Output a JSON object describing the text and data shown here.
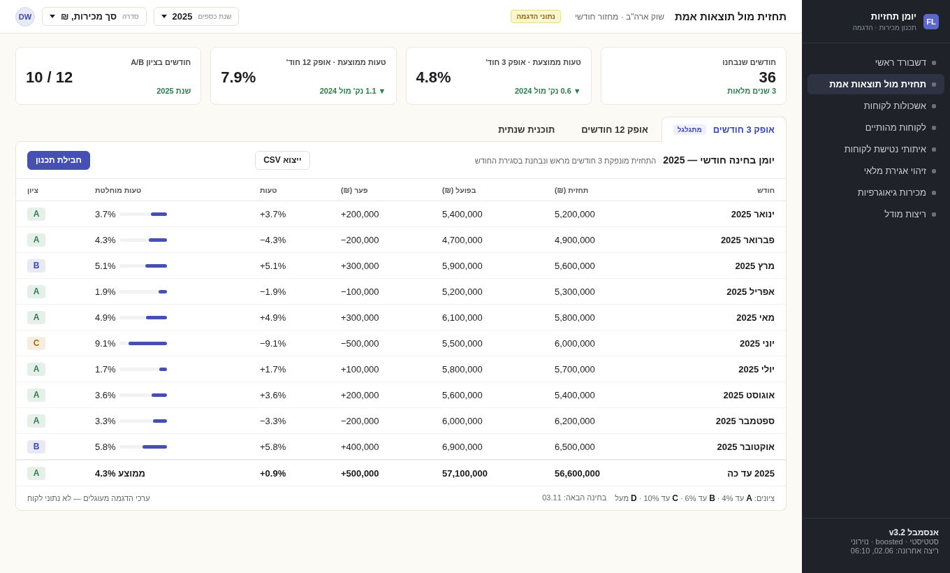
{
  "sidebar": {
    "logo": "FL",
    "title": "יומן תחזיות",
    "subtitle": "תכנון מכירות · הדגמה",
    "items": [
      {
        "label": "דשבורד ראשי",
        "selected": false
      },
      {
        "label": "תחזית מול תוצאות אמת",
        "selected": true
      },
      {
        "label": "אשכולות לקוחות",
        "selected": false
      },
      {
        "label": "לקוחות מהותיים",
        "selected": false
      },
      {
        "label": "איתותי נטישת לקוחות",
        "selected": false
      },
      {
        "label": "זיהוי אגירת מלאי",
        "selected": false
      },
      {
        "label": "מכירות גיאוגרפיות",
        "selected": false
      },
      {
        "label": "ריצות מודל",
        "selected": false
      }
    ],
    "footer": {
      "title": "אנסמבל v3.2",
      "lines": [
        "סטטיסטי · boosted · נוירוני",
        "ריצה אחרונה: 02.06, 06:10"
      ]
    }
  },
  "header": {
    "title": "תחזית מול תוצאות אמת",
    "subtitle": "שוק ארה\"ב · מחזור חודשי",
    "badge": "נתוני הדגמה",
    "filters": [
      {
        "label": "שנת כספים",
        "value": "2025"
      },
      {
        "label": "סדרה",
        "value": "סך מכירות, ₪"
      }
    ],
    "avatar": "DW"
  },
  "kpis": [
    {
      "kind": "total",
      "label": "חודשים שנבחנו",
      "value": "36",
      "note": "3 שנים מלאות"
    },
    {
      "kind": "metric",
      "label": "טעות ממוצעת · אופק 3 חוד'",
      "value": "4.8%",
      "note": "▼ 0.6 נק' מול 2024"
    },
    {
      "kind": "metric",
      "label": "טעות ממוצעת · אופק 12 חוד'",
      "value": "7.9%",
      "note": "▼ 1.1 נק' מול 2024"
    },
    {
      "kind": "metric",
      "label": "חודשים בציון A/B",
      "value": "10 / 12",
      "note": "שנת 2025"
    }
  ],
  "tabs": [
    {
      "label": "אופק 3 חודשים",
      "badge": "מתגלגל",
      "selected": true
    },
    {
      "label": "אופק 12 חודשים",
      "selected": false
    },
    {
      "label": "תוכנית שנתית",
      "selected": false
    }
  ],
  "panel": {
    "title": "יומן בחינה חודשי — 2025",
    "subtitle": "התחזית מונפקת 3 חודשים מראש ונבחנת בסגירת החודש",
    "buttons": [
      {
        "label": "ייצוא CSV",
        "kind": "secondary"
      },
      {
        "label": "חבילת תכנון",
        "kind": "primary"
      }
    ]
  },
  "table": {
    "columns": [
      "חודש",
      "תחזית (₪)",
      "בפועל (₪)",
      "פער (₪)",
      "טעות",
      "טעות מוחלטת",
      "ציון"
    ],
    "rows": [
      {
        "month": "ינואר 2025",
        "forecast": "5,200,000",
        "actual": "5,400,000",
        "gap": "+200,000",
        "error": "+3.7%",
        "abs_error": "3.7%",
        "level": 0.33,
        "grade": {
          "label": "A",
          "color": "#2e7d4e"
        }
      },
      {
        "month": "פברואר 2025",
        "forecast": "4,900,000",
        "actual": "4,700,000",
        "gap": "−200,000",
        "error": "−4.3%",
        "abs_error": "4.3%",
        "level": 0.38,
        "grade": {
          "label": "A",
          "color": "#2e7d4e"
        }
      },
      {
        "month": "מרץ 2025",
        "forecast": "5,600,000",
        "actual": "5,900,000",
        "gap": "+300,000",
        "error": "+5.1%",
        "abs_error": "5.1%",
        "level": 0.45,
        "grade": {
          "label": "B",
          "color": "#3f4aa8"
        }
      },
      {
        "month": "אפריל 2025",
        "forecast": "5,300,000",
        "actual": "5,200,000",
        "gap": "−100,000",
        "error": "−1.9%",
        "abs_error": "1.9%",
        "level": 0.17,
        "grade": {
          "label": "A",
          "color": "#2e7d4e"
        }
      },
      {
        "month": "מאי 2025",
        "forecast": "5,800,000",
        "actual": "6,100,000",
        "gap": "+300,000",
        "error": "+4.9%",
        "abs_error": "4.9%",
        "level": 0.43,
        "grade": {
          "label": "A",
          "color": "#2e7d4e"
        }
      },
      {
        "month": "יוני 2025",
        "forecast": "6,000,000",
        "actual": "5,500,000",
        "gap": "−500,000",
        "error": "−9.1%",
        "abs_error": "9.1%",
        "level": 0.8,
        "grade": {
          "label": "C",
          "color": "#a86b0c"
        }
      },
      {
        "month": "יולי 2025",
        "forecast": "5,700,000",
        "actual": "5,800,000",
        "gap": "+100,000",
        "error": "+1.7%",
        "abs_error": "1.7%",
        "level": 0.15,
        "grade": {
          "label": "A",
          "color": "#2e7d4e"
        }
      },
      {
        "month": "אוגוסט 2025",
        "forecast": "5,400,000",
        "actual": "5,600,000",
        "gap": "+200,000",
        "error": "+3.6%",
        "abs_error": "3.6%",
        "level": 0.32,
        "grade": {
          "label": "A",
          "color": "#2e7d4e"
        }
      },
      {
        "month": "ספטמבר 2025",
        "forecast": "6,200,000",
        "actual": "6,000,000",
        "gap": "−200,000",
        "error": "−3.3%",
        "abs_error": "3.3%",
        "level": 0.29,
        "grade": {
          "label": "A",
          "color": "#2e7d4e"
        }
      },
      {
        "month": "אוקטובר 2025",
        "forecast": "6,500,000",
        "actual": "6,900,000",
        "gap": "+400,000",
        "error": "+5.8%",
        "abs_error": "5.8%",
        "level": 0.51,
        "grade": {
          "label": "B",
          "color": "#3f4aa8"
        }
      }
    ],
    "total": {
      "month": "2025 עד כה",
      "forecast": "56,600,000",
      "actual": "57,100,000",
      "gap": "+500,000",
      "error": "+0.9%",
      "abs_error": "ממוצע 4.3%",
      "grade": {
        "label": "A",
        "color": "#2e7d4e"
      }
    }
  },
  "legend": "ציונים: **A** עד 4% · **B** עד 6% · **C** עד 10% · **D** מעל",
  "next_review": "בחינה הבאה: 03.11",
  "note": "ערכי הדגמה מעוגלים — לא נתוני לקוח"
}
